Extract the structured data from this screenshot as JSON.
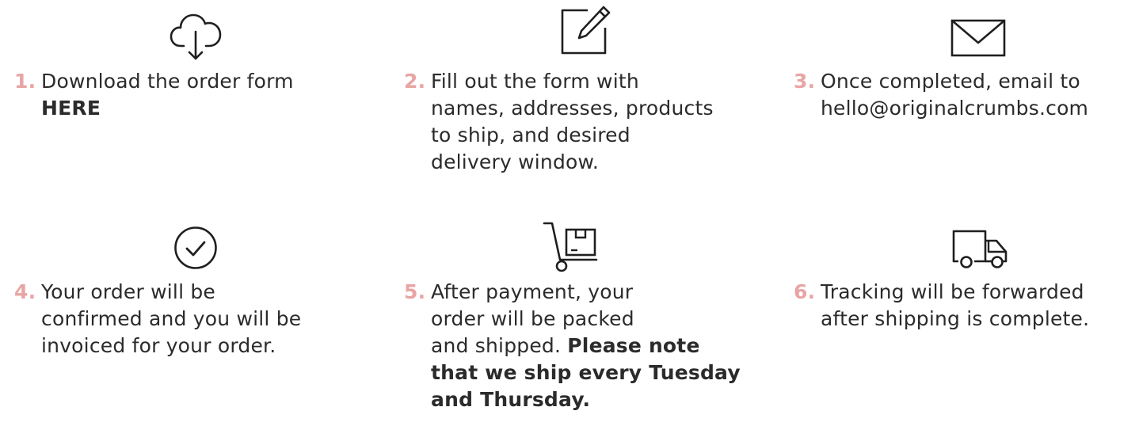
{
  "colors": {
    "accent": "#e9a4a4",
    "text": "#2b2b2b",
    "icon_stroke": "#1f1f1f"
  },
  "steps": [
    {
      "number": "1.",
      "icon": "cloud-download-icon",
      "lines": [
        "Download the order form"
      ],
      "bold_lines": [
        "HERE"
      ]
    },
    {
      "number": "2.",
      "icon": "edit-form-icon",
      "lines": [
        "Fill out the form with",
        "names, addresses, products",
        "to ship, and desired",
        "delivery window."
      ]
    },
    {
      "number": "3.",
      "icon": "envelope-icon",
      "lines": [
        "Once completed, email to",
        "hello@originalcrumbs.com"
      ]
    },
    {
      "number": "4.",
      "icon": "check-circle-icon",
      "lines": [
        "Your order will be",
        "confirmed and you will be",
        "invoiced for your order."
      ]
    },
    {
      "number": "5.",
      "icon": "hand-truck-icon",
      "lines": [
        "After payment, your",
        "order will be packed"
      ],
      "mixed_line": {
        "plain": "and shipped. ",
        "bold": "Please note"
      },
      "bold_lines": [
        "that we ship every Tuesday",
        "and Thursday."
      ]
    },
    {
      "number": "6.",
      "icon": "delivery-truck-icon",
      "lines": [
        "Tracking will be forwarded",
        "after shipping is complete."
      ]
    }
  ]
}
